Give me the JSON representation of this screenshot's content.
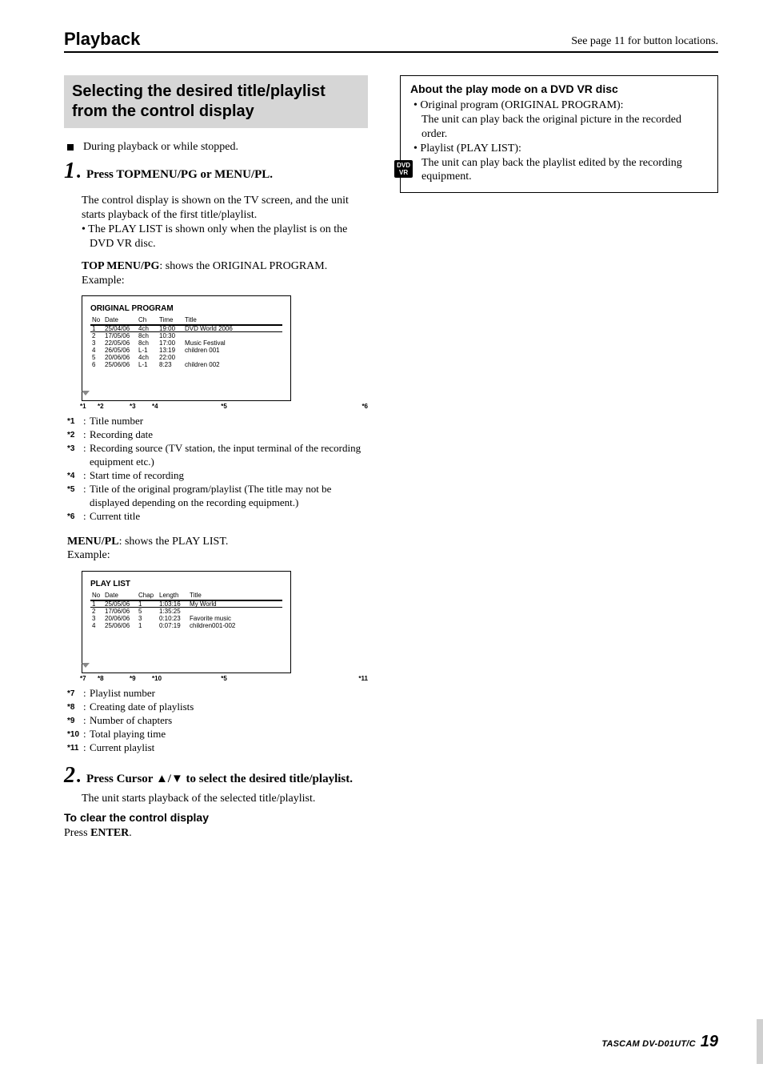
{
  "header": {
    "title": "Playback",
    "right_note": "See page 11 for button locations."
  },
  "section": {
    "heading": "Selecting the desired title/playlist from the control display",
    "precond": "During playback or while stopped.",
    "badge_top": "DVD",
    "badge_bottom": "VR",
    "step1": {
      "num": "1",
      "text": "Press TOPMENU/PG or MENU/PL."
    },
    "step1_body": {
      "p1": "The control display is shown on the TV screen, and the unit starts playback of the first title/playlist.",
      "p2": "• The PLAY LIST is shown only when the playlist is on the DVD VR disc.",
      "topmenu_label_prefix": "TOP MENU/PG",
      "topmenu_label_suffix": ": shows the ORIGINAL PROGRAM.",
      "example_label": "Example:"
    },
    "original_program": {
      "caption": "ORIGINAL PROGRAM",
      "headers": [
        "No",
        "Date",
        "Ch",
        "Time",
        "Title"
      ],
      "rows": [
        {
          "no": "1",
          "date": "25/04/06",
          "ch": "4ch",
          "time": "19:00",
          "title": "DVD World 2006"
        },
        {
          "no": "2",
          "date": "17/05/06",
          "ch": "8ch",
          "time": "10:30",
          "title": ""
        },
        {
          "no": "3",
          "date": "22/05/06",
          "ch": "8ch",
          "time": "17:00",
          "title": "Music Festival"
        },
        {
          "no": "4",
          "date": "26/05/06",
          "ch": "L-1",
          "time": "13:19",
          "title": "children 001"
        },
        {
          "no": "5",
          "date": "20/06/06",
          "ch": "4ch",
          "time": "22:00",
          "title": ""
        },
        {
          "no": "6",
          "date": "25/06/06",
          "ch": "L-1",
          "time": "8:23",
          "title": "children 002"
        }
      ],
      "hi_index": 0,
      "labels": [
        "*1",
        "*2",
        "*3",
        "*4",
        "*5",
        "*6"
      ]
    },
    "original_footnotes": [
      {
        "k": "*1",
        "v": "Title number"
      },
      {
        "k": "*2",
        "v": "Recording date"
      },
      {
        "k": "*3",
        "v": "Recording source (TV station, the input terminal of the recording equipment etc.)"
      },
      {
        "k": "*4",
        "v": "Start time of recording"
      },
      {
        "k": "*5",
        "v": "Title of the original program/playlist (The title may not be displayed depending on the recording equipment.)"
      },
      {
        "k": "*6",
        "v": "Current title"
      }
    ],
    "menupl_label_prefix": "MENU/PL",
    "menupl_label_suffix": ": shows the PLAY LIST.",
    "playlist": {
      "caption": "PLAY LIST",
      "headers": [
        "No",
        "Date",
        "Chap",
        "Length",
        "Title"
      ],
      "rows": [
        {
          "no": "1",
          "date": "25/05/06",
          "chap": "1",
          "len": "1:03:16",
          "title": "My World"
        },
        {
          "no": "2",
          "date": "17/06/06",
          "chap": "5",
          "len": "1:35:25",
          "title": ""
        },
        {
          "no": "3",
          "date": "20/06/06",
          "chap": "3",
          "len": "0:10:23",
          "title": "Favorite music"
        },
        {
          "no": "4",
          "date": "25/06/06",
          "chap": "1",
          "len": "0:07:19",
          "title": "children001-002"
        }
      ],
      "hi_index": 0,
      "labels": [
        "*7",
        "*8",
        "*9",
        "*10",
        "*5",
        "*11"
      ]
    },
    "playlist_footnotes": [
      {
        "k": "*7",
        "v": "Playlist number"
      },
      {
        "k": "*8",
        "v": "Creating date of playlists"
      },
      {
        "k": "*9",
        "v": "Number of chapters"
      },
      {
        "k": "*10",
        "v": "Total playing time"
      },
      {
        "k": "*11",
        "v": "Current playlist"
      }
    ],
    "step2": {
      "num": "2",
      "text": "Press Cursor ▲/▼ to select the desired title/playlist."
    },
    "step2_body": "The unit starts playback of the selected title/playlist.",
    "clear_title": "To clear the control display",
    "clear_body_prefix": "Press ",
    "clear_body_bold": "ENTER",
    "clear_body_suffix": "."
  },
  "about": {
    "title": "About the play mode on a DVD VR disc",
    "items": [
      {
        "head": "Original program (ORIGINAL PROGRAM):",
        "body": "The unit can play back the original picture in the recorded order."
      },
      {
        "head": "Playlist (PLAY LIST):",
        "body": "The unit can play back the playlist edited by the recording equipment."
      }
    ]
  },
  "footer": {
    "model": "TASCAM DV-D01UT/C",
    "page": "19"
  }
}
